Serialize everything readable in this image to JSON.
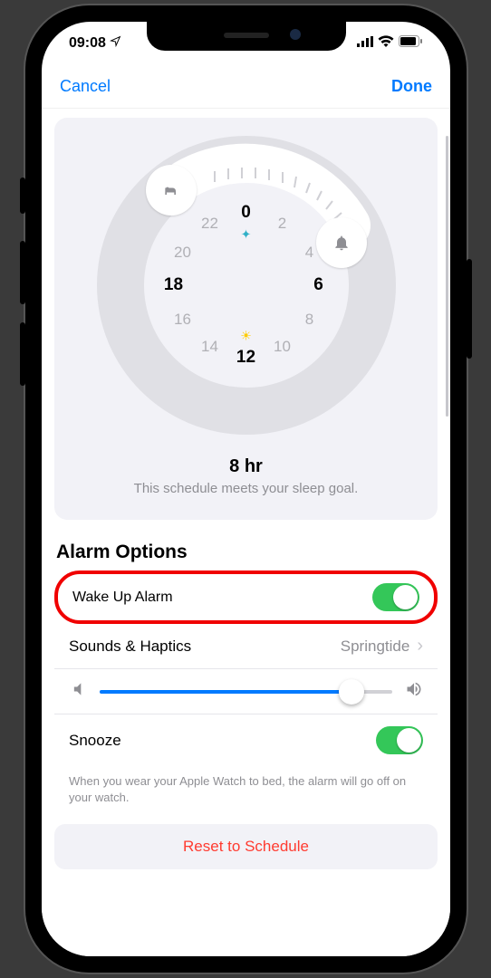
{
  "status": {
    "time": "09:08"
  },
  "nav": {
    "cancel": "Cancel",
    "done": "Done"
  },
  "dial": {
    "numbers": [
      "0",
      "2",
      "4",
      "6",
      "8",
      "10",
      "12",
      "14",
      "16",
      "18",
      "20",
      "22"
    ],
    "bold_numbers": [
      "0",
      "6",
      "12",
      "18"
    ]
  },
  "duration": {
    "main": "8 hr",
    "sub": "This schedule meets your sleep goal."
  },
  "section_title": "Alarm Options",
  "rows": {
    "wake": {
      "label": "Wake Up Alarm",
      "on": true
    },
    "sounds": {
      "label": "Sounds & Haptics",
      "value": "Springtide"
    },
    "volume": {
      "value": 86
    },
    "snooze": {
      "label": "Snooze",
      "on": true
    }
  },
  "footer_note": "When you wear your Apple Watch to bed, the alarm will go off on your watch.",
  "reset": "Reset to Schedule"
}
